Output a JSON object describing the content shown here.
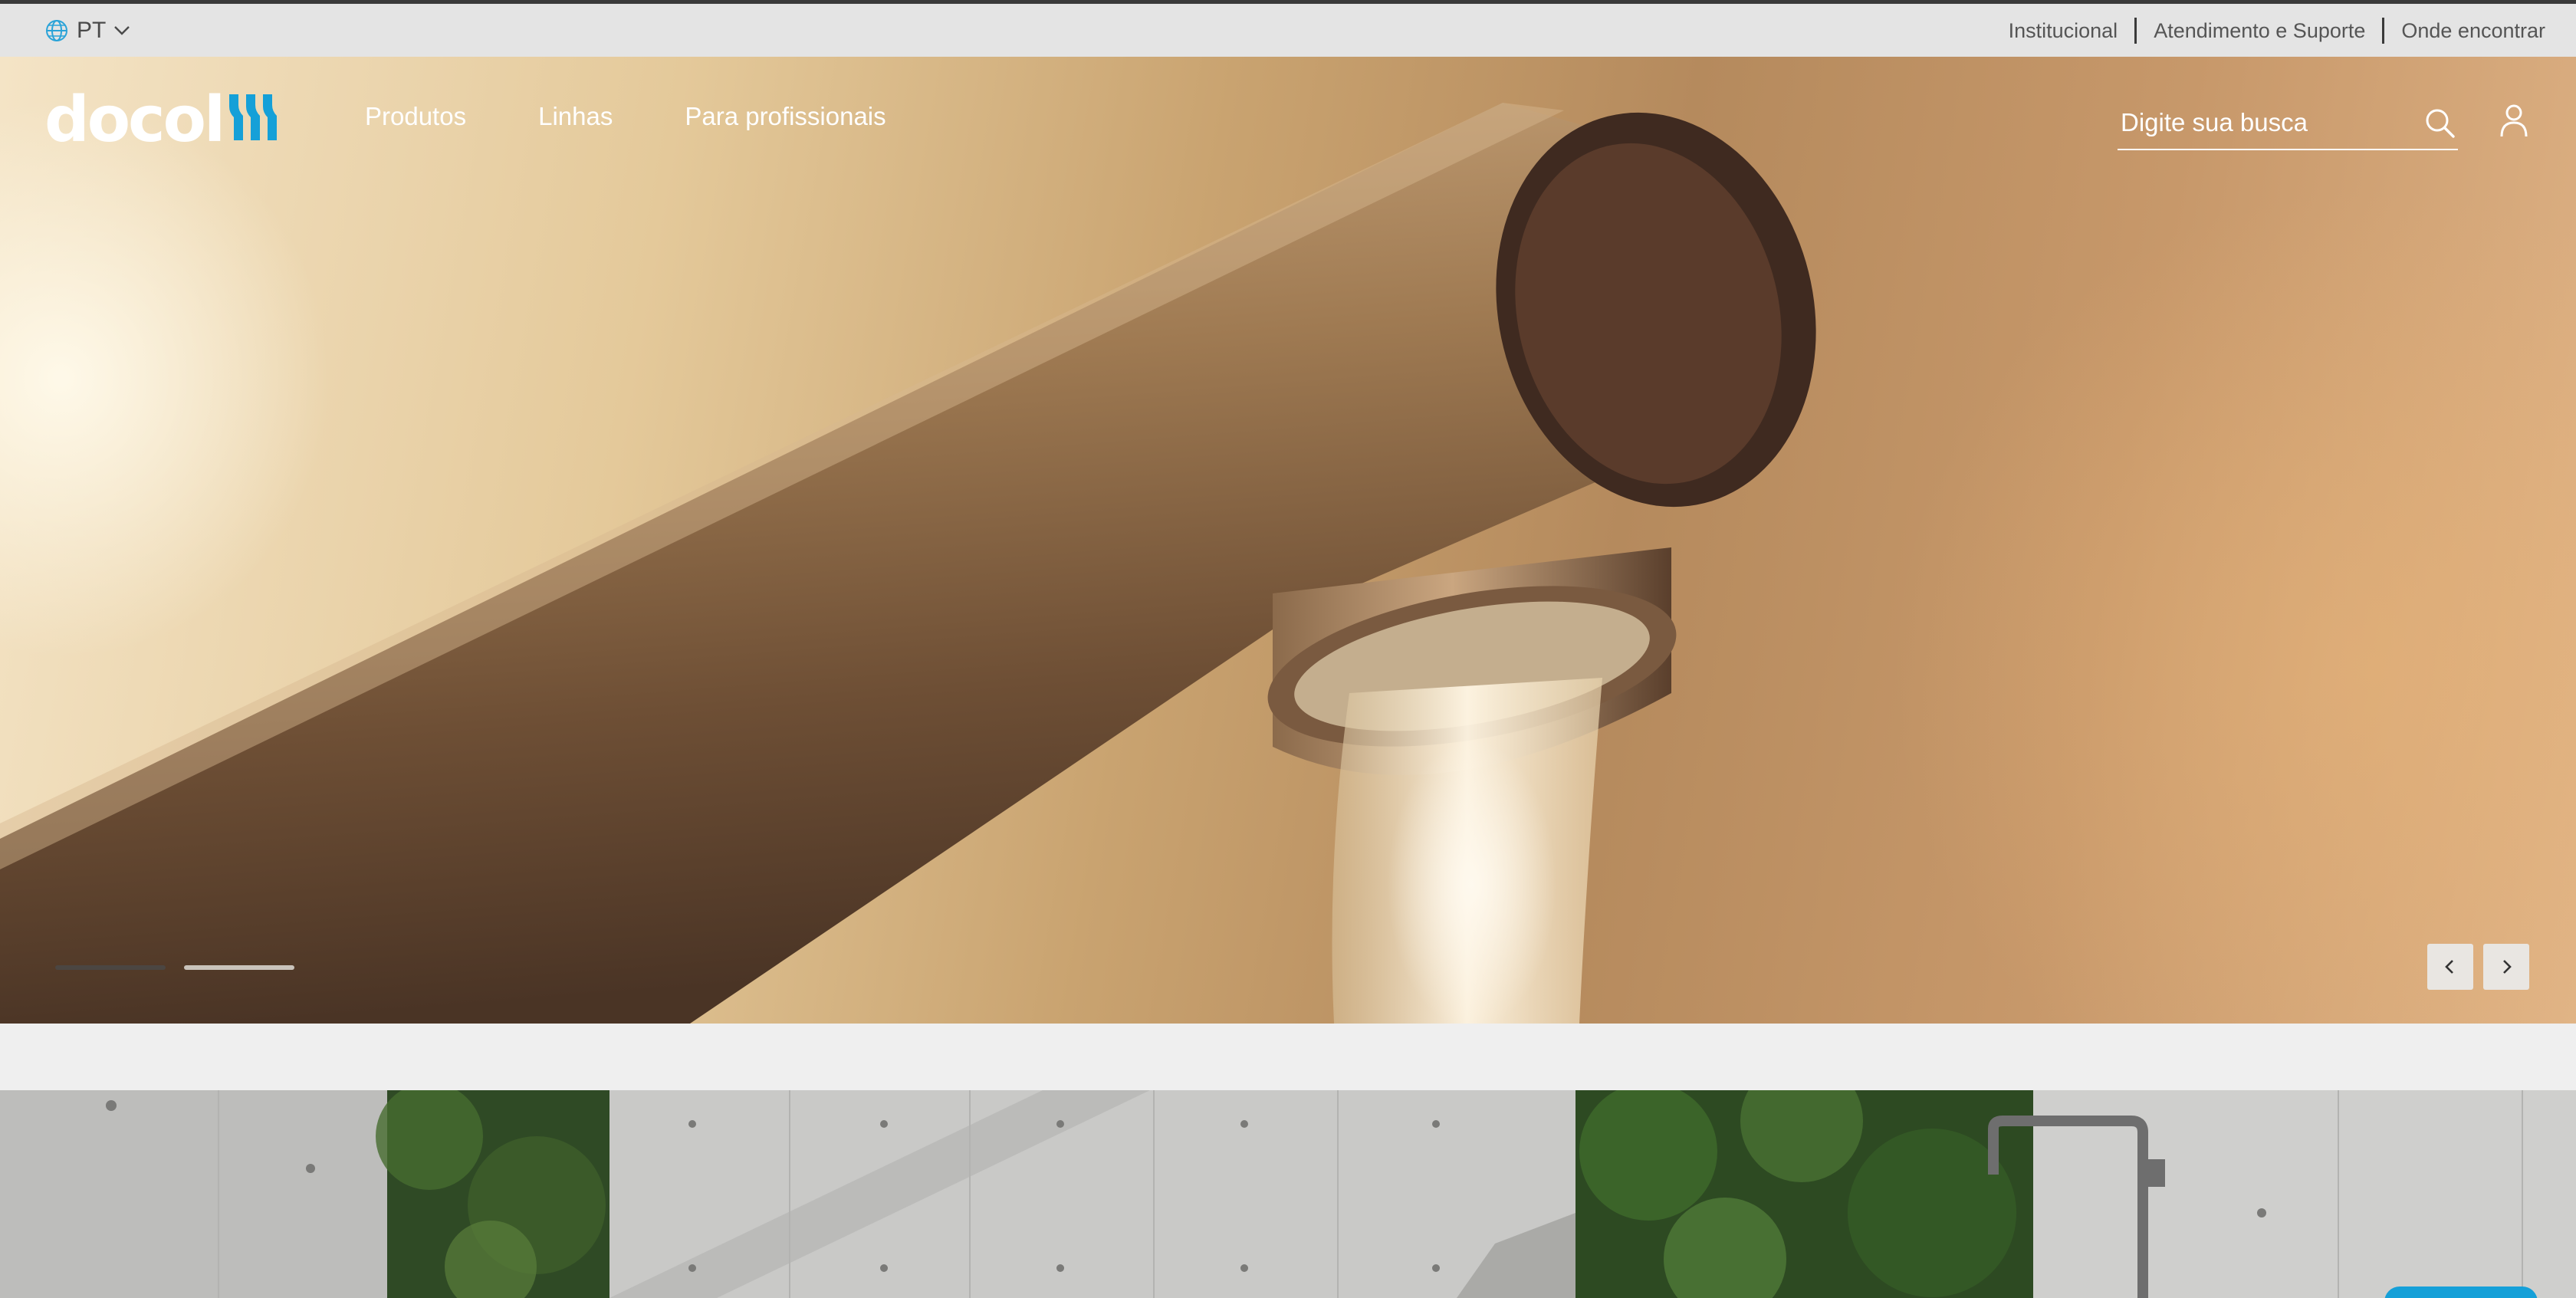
{
  "topbar": {
    "language": "PT",
    "links": [
      {
        "label": "Institucional"
      },
      {
        "label": "Atendimento e Suporte"
      },
      {
        "label": "Onde encontrar"
      }
    ]
  },
  "header": {
    "logo_text": "docol",
    "nav": [
      {
        "label": "Produtos"
      },
      {
        "label": "Linhas"
      },
      {
        "label": "Para profissionais"
      }
    ],
    "search_placeholder": "Digite sua busca"
  },
  "hero": {
    "slides_total": 2,
    "active_slide": 1
  },
  "colors": {
    "brand_blue": "#15a0d8",
    "utility_bar": "#e4e4e4",
    "indicator_active": "#4b4642",
    "indicator_inactive": "#c9c3bb"
  },
  "icons": [
    "globe-icon",
    "chevron-down-icon",
    "search-icon",
    "user-icon",
    "chevron-left-icon",
    "chevron-right-icon"
  ]
}
